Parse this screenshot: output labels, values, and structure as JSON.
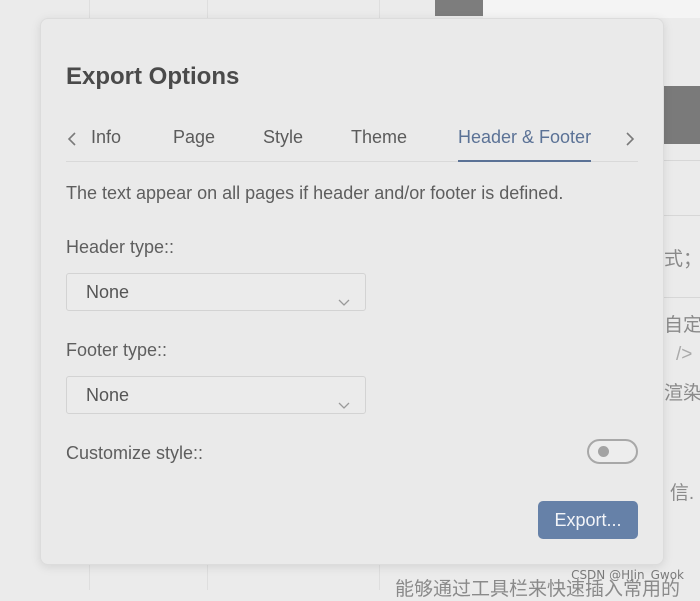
{
  "dialog": {
    "title": "Export Options",
    "tabs": [
      {
        "label": "Info",
        "active": false
      },
      {
        "label": "Page",
        "active": false
      },
      {
        "label": "Style",
        "active": false
      },
      {
        "label": "Theme",
        "active": false
      },
      {
        "label": "Header & Footer",
        "active": true
      }
    ],
    "description": "The text appear on all pages if header and/or footer is defined.",
    "header_type": {
      "label": "Header type::",
      "value": "None"
    },
    "footer_type": {
      "label": "Footer type::",
      "value": "None"
    },
    "customize_style": {
      "label": "Customize style::",
      "enabled": false
    },
    "export_label": "Export...",
    "colors": {
      "accent": "#5b7296",
      "button": "#6681a8"
    }
  },
  "background": {
    "fragments": [
      "式；",
      "自定",
      "/>",
      "渲染",
      "g 信.",
      "能够通过工具栏来快速插入常用的"
    ],
    "watermark": "CSDN @HJin_Gwok"
  }
}
